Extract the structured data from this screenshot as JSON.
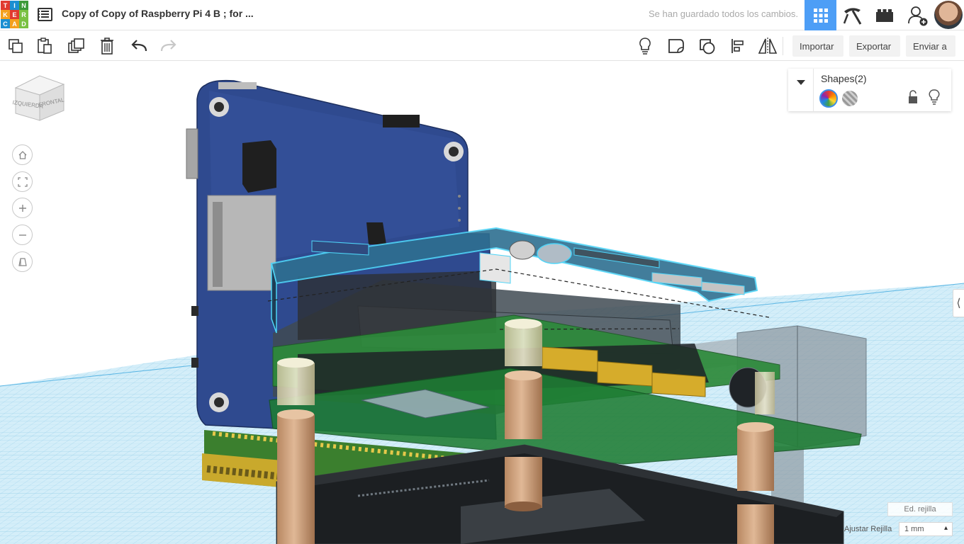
{
  "app": {
    "logo_letters": [
      "T",
      "I",
      "N",
      "K",
      "E",
      "R",
      "C",
      "A",
      "D"
    ],
    "logo_colors": [
      "#e13a2f",
      "#1b8fd2",
      "#3d9a3a",
      "#f4a11d",
      "#e13a2f",
      "#7ac142",
      "#1b8fd2",
      "#f4a11d",
      "#7ac142"
    ],
    "accent": "#4d9ef6"
  },
  "header": {
    "doc_title": "Copy of Copy of Raspberry Pi 4 B ; for ...",
    "save_status": "Se han guardado todos los cambios.",
    "nav": {
      "grid_icon": "grid-view-icon",
      "pickaxe_icon": "pickaxe-icon",
      "bricks_icon": "bricks-icon",
      "add_user_icon": "add-user-icon"
    }
  },
  "toolbar": {
    "left_icons": [
      "copy-icon",
      "paste-icon",
      "duplicate-icon",
      "delete-icon",
      "undo-icon",
      "redo-icon"
    ],
    "right_icons": [
      "light-bulb-icon",
      "note-icon",
      "shape-group-icon",
      "align-icon",
      "mirror-icon"
    ],
    "import_label": "Importar",
    "export_label": "Exportar",
    "send_label": "Enviar a"
  },
  "viewcube": {
    "left_face": "IZQUIERDA",
    "front_face": "FRONTAL"
  },
  "view_controls": [
    "home-icon",
    "fit-view-icon",
    "zoom-in-icon",
    "zoom-out-icon",
    "perspective-icon"
  ],
  "shapes_panel": {
    "title": "Shapes(2)",
    "solid_color": "multicolor",
    "hole": "hole"
  },
  "grid": {
    "edit_label": "Ed. rejilla",
    "snap_label": "Ajustar Rejilla",
    "snap_value": "1 mm"
  }
}
